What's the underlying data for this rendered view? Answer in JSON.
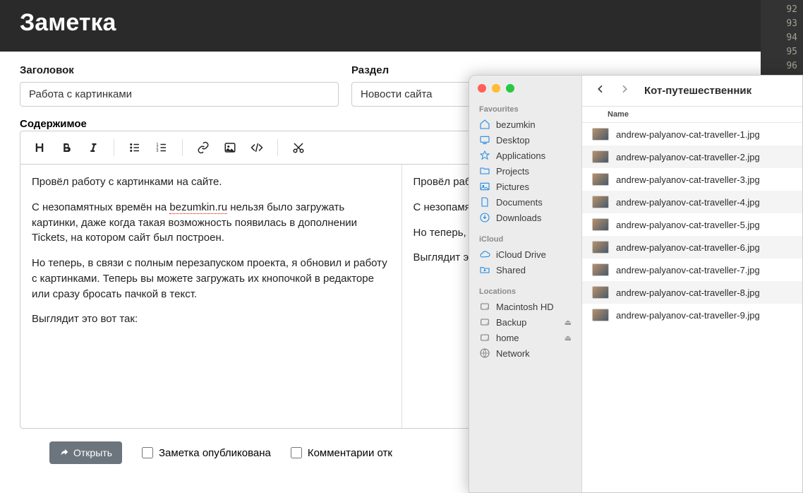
{
  "header": {
    "title": "Заметка"
  },
  "gutter": [
    "92",
    "93",
    "94",
    "95",
    "96"
  ],
  "form": {
    "title_label": "Заголовок",
    "title_value": "Работа с картинками",
    "section_label": "Раздел",
    "section_value": "Новости сайта",
    "content_label": "Содержимое"
  },
  "editor_left": {
    "p1": "Провёл работу с картинками на сайте.",
    "p2a": "С незопамятных времён на ",
    "p2link": "bezumkin.ru",
    "p2b": " нельзя было загружать картинки, даже когда такая возможность появилась в дополнении Tickets, на котором сайт был построен.",
    "p3": "Но теперь, в связи с полным перезапуском проекта, я обновил и работу с картинками. Теперь вы можете загружать их кнопочкой в редакторе или сразу бросать пачкой в текст.",
    "p4": "Выглядит это вот так:"
  },
  "editor_right": {
    "p1": "Провёл работу с карт",
    "p2": "С незопамятных време картинки, даже когда т дополнении Tickets, на",
    "p3": "Но теперь, в связи с по и работу с картинками кнопочкой в редакторе",
    "p4": "Выглядит это вот так:"
  },
  "bottom": {
    "open": "Открыть",
    "published": "Заметка опубликована",
    "comments": "Комментарии отк"
  },
  "finder": {
    "folder_title": "Кот-путешественник",
    "name_header": "Name",
    "sections": {
      "favourites": "Favourites",
      "icloud": "iCloud",
      "locations": "Locations"
    },
    "favourites": [
      {
        "label": "bezumkin",
        "icon": "home"
      },
      {
        "label": "Desktop",
        "icon": "desktop"
      },
      {
        "label": "Applications",
        "icon": "apps"
      },
      {
        "label": "Projects",
        "icon": "folder"
      },
      {
        "label": "Pictures",
        "icon": "pictures"
      },
      {
        "label": "Documents",
        "icon": "doc"
      },
      {
        "label": "Downloads",
        "icon": "download"
      }
    ],
    "icloud": [
      {
        "label": "iCloud Drive",
        "icon": "cloud"
      },
      {
        "label": "Shared",
        "icon": "sharedfolder"
      }
    ],
    "locations": [
      {
        "label": "Macintosh HD",
        "icon": "disk",
        "eject": false
      },
      {
        "label": "Backup",
        "icon": "disk",
        "eject": true
      },
      {
        "label": "home",
        "icon": "disk",
        "eject": true
      },
      {
        "label": "Network",
        "icon": "network",
        "eject": false
      }
    ],
    "files": [
      "andrew-palyanov-cat-traveller-1.jpg",
      "andrew-palyanov-cat-traveller-2.jpg",
      "andrew-palyanov-cat-traveller-3.jpg",
      "andrew-palyanov-cat-traveller-4.jpg",
      "andrew-palyanov-cat-traveller-5.jpg",
      "andrew-palyanov-cat-traveller-6.jpg",
      "andrew-palyanov-cat-traveller-7.jpg",
      "andrew-palyanov-cat-traveller-8.jpg",
      "andrew-palyanov-cat-traveller-9.jpg"
    ]
  }
}
